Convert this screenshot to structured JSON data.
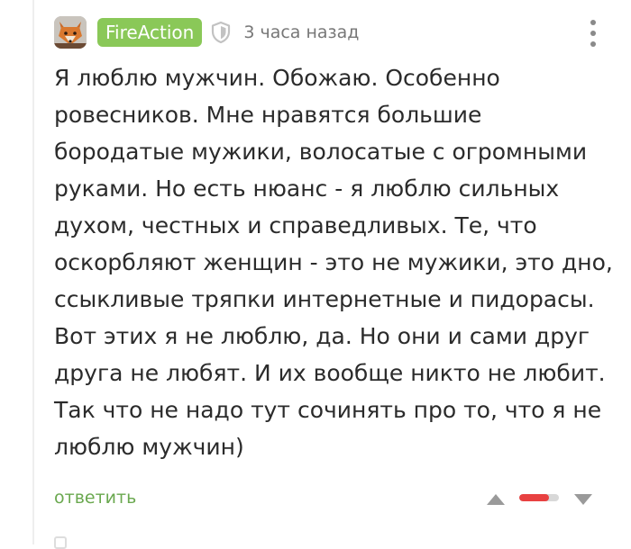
{
  "comment": {
    "author": "FireAction",
    "avatar_icon": "fox-avatar",
    "verified_icon": "shield-icon",
    "time": "3 часа назад",
    "menu_icon": "more-vertical-icon",
    "text": "Я люблю мужчин. Обожаю. Особенно\nровесников. Мне нравятся большие\nбородатые мужики, волосатые с огромными\nруками. Но есть нюанс - я люблю сильных\nдухом, честных и справедливых. Те, что\nоскорбляют женщин - это не мужики, это дно,\nссыкливые тряпки интернетные и пидорасы.\nВот этих я не люблю, да. Но они и сами друг\nдруга не любят. И их вообще никто не любит.\nТак что не надо тут сочинять про то, что я не\nлюблю мужчин)",
    "reply_label": "ответить",
    "rating": {
      "upvote_icon": "triangle-up-icon",
      "downvote_icon": "triangle-down-icon",
      "negative_share": 0.75,
      "bar_color": "#e84141"
    }
  },
  "colors": {
    "username_bg": "#8ac858",
    "reply_link": "#6aa84f",
    "text": "#2b2b2b",
    "meta": "#777777"
  }
}
